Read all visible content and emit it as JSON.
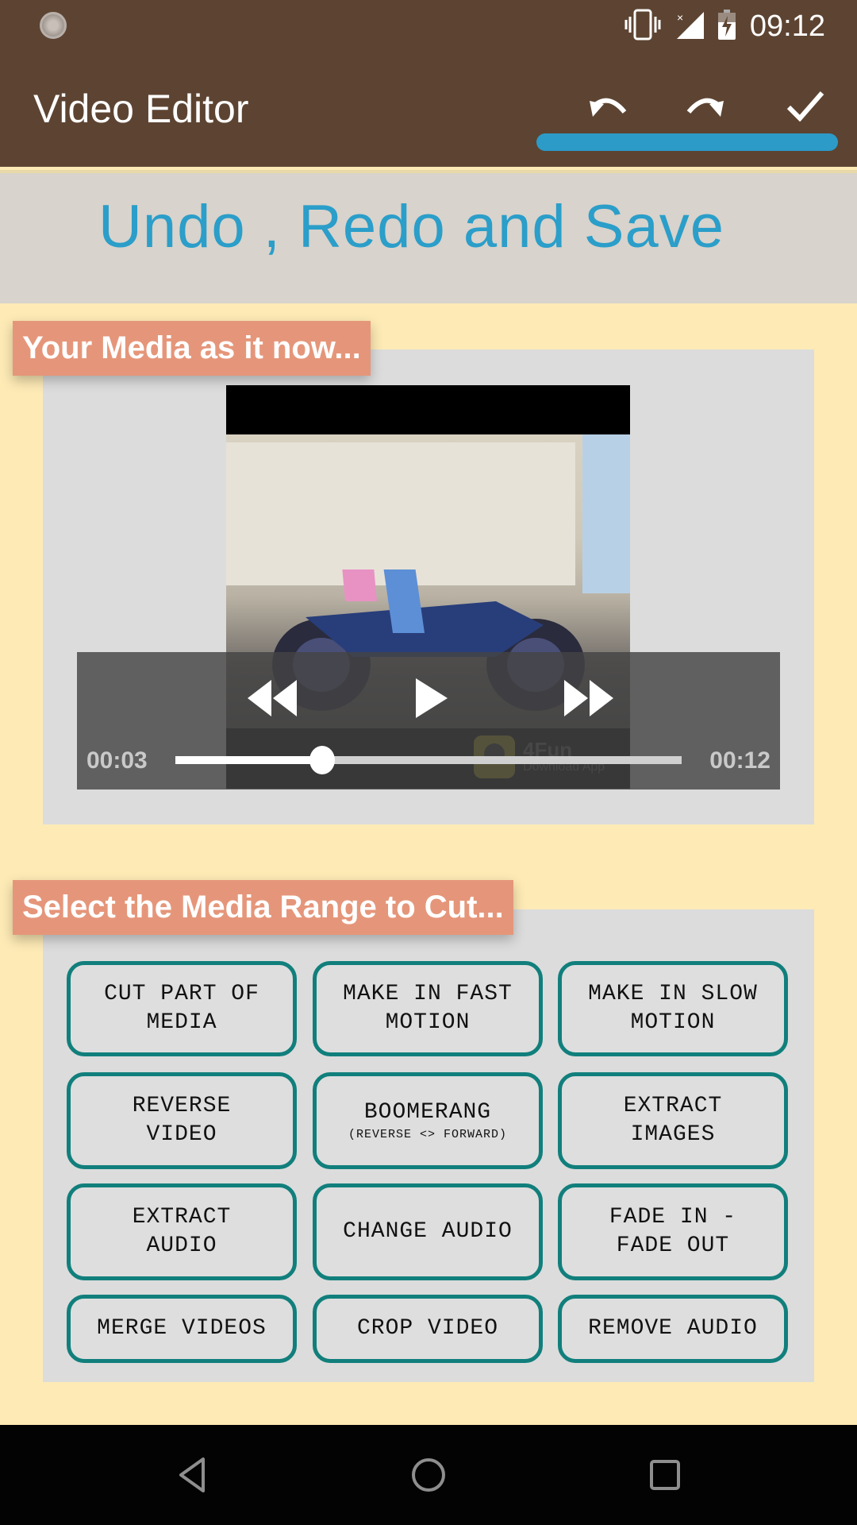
{
  "status_bar": {
    "time": "09:12",
    "icons": [
      "loading-spinner-icon",
      "vibrate-icon",
      "no-signal-icon",
      "battery-charging-icon"
    ]
  },
  "app_bar": {
    "title": "Video Editor",
    "actions": [
      {
        "name": "undo",
        "icon": "undo-icon"
      },
      {
        "name": "redo",
        "icon": "redo-icon"
      },
      {
        "name": "save",
        "icon": "check-icon"
      }
    ],
    "highlight_color": "#2c9bc8"
  },
  "banner": {
    "text": "Undo , Redo and Save"
  },
  "media_section": {
    "label": "Your Media as it now...",
    "player": {
      "current_time": "00:03",
      "total_time": "00:12",
      "progress": 0.29,
      "watermark_title": "4Fun",
      "watermark_subtitle": "Download App",
      "controls": [
        "rewind-icon",
        "play-icon",
        "fast-forward-icon"
      ]
    }
  },
  "tools_section": {
    "label": "Select the Media Range to Cut...",
    "buttons": [
      {
        "lines": [
          "CUT PART OF",
          "MEDIA"
        ]
      },
      {
        "lines": [
          "MAKE IN FAST",
          "MOTION"
        ]
      },
      {
        "lines": [
          "MAKE IN SLOW",
          "MOTION"
        ]
      },
      {
        "lines": [
          "REVERSE",
          "VIDEO"
        ]
      },
      {
        "lines": [
          "BOOMERANG"
        ],
        "sub": "(REVERSE <> FORWARD)"
      },
      {
        "lines": [
          "EXTRACT",
          "IMAGES"
        ]
      },
      {
        "lines": [
          "EXTRACT",
          "AUDIO"
        ]
      },
      {
        "lines": [
          "CHANGE AUDIO"
        ]
      },
      {
        "lines": [
          "FADE IN -",
          "FADE OUT"
        ]
      },
      {
        "lines": [
          "MERGE VIDEOS"
        ]
      },
      {
        "lines": [
          "CROP VIDEO"
        ]
      },
      {
        "lines": [
          "REMOVE AUDIO"
        ]
      }
    ],
    "accent": "#117f7c"
  },
  "nav_bar": {
    "buttons": [
      "back-icon",
      "home-icon",
      "recents-icon"
    ]
  }
}
